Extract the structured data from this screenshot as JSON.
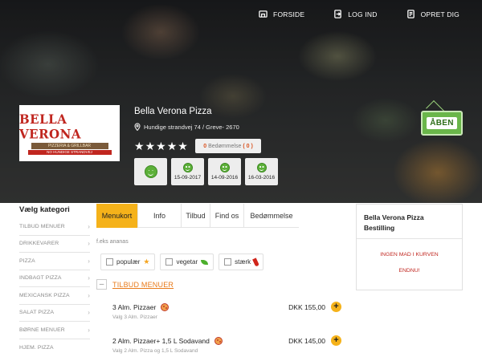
{
  "topnav": [
    {
      "label": "FORSIDE",
      "icon": "home-icon"
    },
    {
      "label": "LOG IND",
      "icon": "login-icon"
    },
    {
      "label": "OPRET DIG",
      "icon": "register-icon"
    }
  ],
  "logo": {
    "line1": "BELLA VERONA",
    "line2": "PIZZERIA & GRILLBAR",
    "line3": "NO HUNDIGE STRANDVEJ"
  },
  "restaurant": {
    "name": "Bella Verona Pizza",
    "address": "Hundige strandvej 74 / Greve- 2670",
    "stars": 5,
    "rating_prefix": "0",
    "rating_label": "Bedømmelse",
    "rating_count": "( 0 )",
    "open_label": "ÅBEN",
    "inspection_dates": [
      "15-09-2017",
      "14-09-2016",
      "16-03-2016"
    ]
  },
  "categories": {
    "title": "Vælg kategori",
    "items": [
      "TILBUD MENUER",
      "DRIKKEVARER",
      "PIZZA",
      "INDBAGT PIZZA",
      "MEXICANSK PIZZA",
      "SALAT PIZZA",
      "BØRNE MENUER",
      "HJEM. PIZZA"
    ]
  },
  "tabs": [
    {
      "label": "Menukort",
      "active": true
    },
    {
      "label": "Info",
      "active": false
    },
    {
      "label": "Tilbud",
      "active": false
    },
    {
      "label": "Find os",
      "active": false
    },
    {
      "label": "Bedømmelse",
      "active": false
    }
  ],
  "search": {
    "hint": "f.eks ananas"
  },
  "filters": [
    {
      "label": "populær",
      "icon": "star-icon"
    },
    {
      "label": "vegetar",
      "icon": "leaf-icon"
    },
    {
      "label": "stærk",
      "icon": "chili-icon"
    }
  ],
  "section": {
    "title": "TILBUD MENUER"
  },
  "menu_items": [
    {
      "name": "3 Alm. Pizzaer",
      "desc": "Valg 3 Alm. Pizzaer",
      "price": "DKK 155,00"
    },
    {
      "name": "2 Alm. Pizzaer+ 1,5 L Sodavand",
      "desc": "Valg 2 Alm. Pizza og 1,5 L Sodavand",
      "price": "DKK 145,00"
    }
  ],
  "cart": {
    "title": "Bella Verona Pizza Bestilling",
    "empty_text": "INGEN MAD I KURVEN",
    "endnu": "ENDNU!"
  },
  "colors": {
    "accent": "#f5b21a",
    "section": "#e87a1a",
    "cart_text": "#c0261f",
    "open_sign": "#6ab64a"
  }
}
